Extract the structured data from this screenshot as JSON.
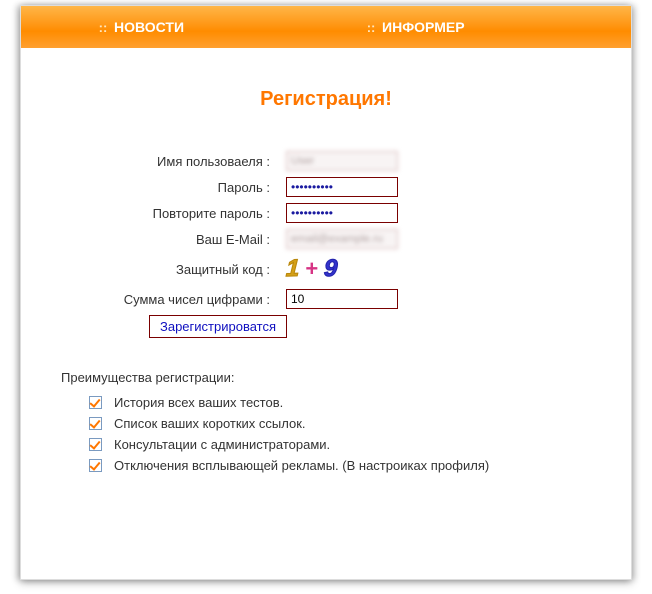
{
  "nav": {
    "news": "НОВОСТИ",
    "informer": "ИНФОРМЕР"
  },
  "title": "Регистрация!",
  "form": {
    "username_label": "Имя пользоваеля :",
    "username_value": "User",
    "password_label": "Пароль :",
    "password_value": "••••••••••",
    "password2_label": "Повторите пароль :",
    "password2_value": "••••••••••",
    "email_label": "Ваш E-Mail :",
    "email_value": "email@example.ru",
    "captcha_label": "Защитный код :",
    "captcha_d1": "1",
    "captcha_op": "+",
    "captcha_d2": "9",
    "sum_label": "Сумма чисел цифрами :",
    "sum_value": "10",
    "submit": "Зарегистрироватся"
  },
  "advantages": {
    "title": "Преимущества регистрации:",
    "items": [
      "История всех ваших тестов.",
      "Список ваших коротких ссылок.",
      "Консультации с администраторами.",
      "Отключения всплывающей рекламы. (В настроиках профиля)"
    ]
  }
}
